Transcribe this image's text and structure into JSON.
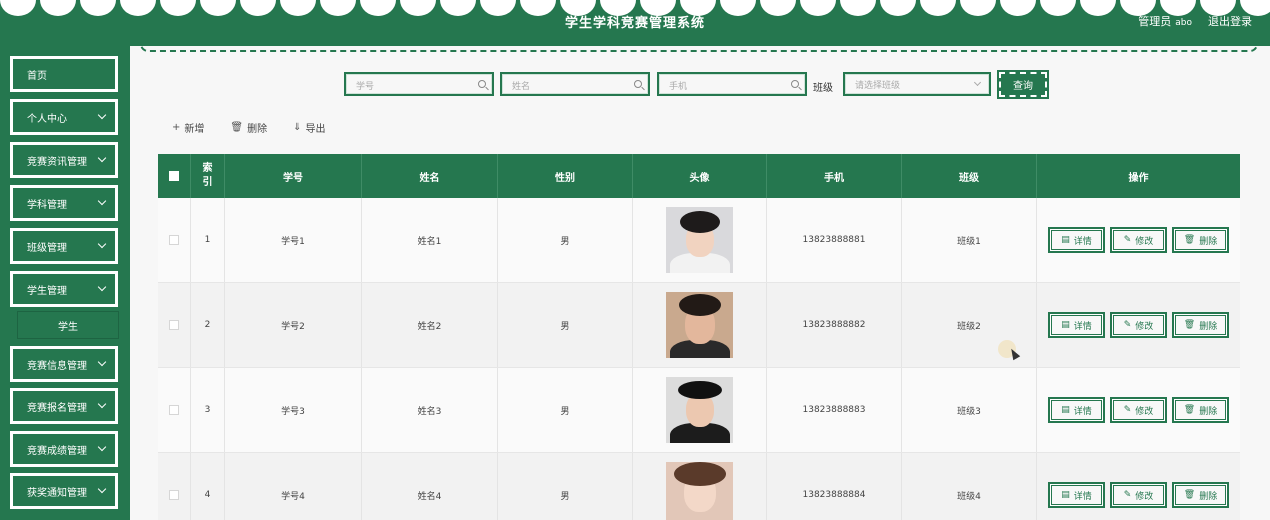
{
  "header": {
    "title": "学生学科竞赛管理系统",
    "role": "管理员",
    "username": "abo",
    "logout": "退出登录"
  },
  "sidebar": {
    "items": [
      {
        "label": "首页",
        "has_children": false
      },
      {
        "label": "个人中心",
        "has_children": true
      },
      {
        "label": "竞赛资讯管理",
        "has_children": true
      },
      {
        "label": "学科管理",
        "has_children": true
      },
      {
        "label": "班级管理",
        "has_children": true
      },
      {
        "label": "学生管理",
        "has_children": true,
        "expanded": true
      },
      {
        "label": "竞赛信息管理",
        "has_children": true
      },
      {
        "label": "竞赛报名管理",
        "has_children": true
      },
      {
        "label": "竞赛成绩管理",
        "has_children": true
      },
      {
        "label": "获奖通知管理",
        "has_children": true
      }
    ],
    "submenu": {
      "label": "学生"
    }
  },
  "search": {
    "student_id_placeholder": "学号",
    "name_placeholder": "姓名",
    "phone_placeholder": "手机",
    "class_label": "班级",
    "class_placeholder": "请选择班级",
    "query_label": "查询"
  },
  "toolbar": {
    "add_label": "新增",
    "delete_label": "删除",
    "export_label": "导出"
  },
  "table": {
    "headers": {
      "index": "索引",
      "student_id": "学号",
      "name": "姓名",
      "gender": "性别",
      "avatar": "头像",
      "phone": "手机",
      "class": "班级",
      "actions": "操作"
    },
    "rows": [
      {
        "index": "1",
        "student_id": "学号1",
        "name": "姓名1",
        "gender": "男",
        "phone": "13823888881",
        "class": "班级1"
      },
      {
        "index": "2",
        "student_id": "学号2",
        "name": "姓名2",
        "gender": "男",
        "phone": "13823888882",
        "class": "班级2"
      },
      {
        "index": "3",
        "student_id": "学号3",
        "name": "姓名3",
        "gender": "男",
        "phone": "13823888883",
        "class": "班级3"
      },
      {
        "index": "4",
        "student_id": "学号4",
        "name": "姓名4",
        "gender": "男",
        "phone": "13823888884",
        "class": "班级4"
      }
    ],
    "actions": {
      "detail": "详情",
      "edit": "修改",
      "delete": "删除"
    }
  },
  "colors": {
    "primary": "#25774f",
    "background": "#f7f7f7"
  }
}
